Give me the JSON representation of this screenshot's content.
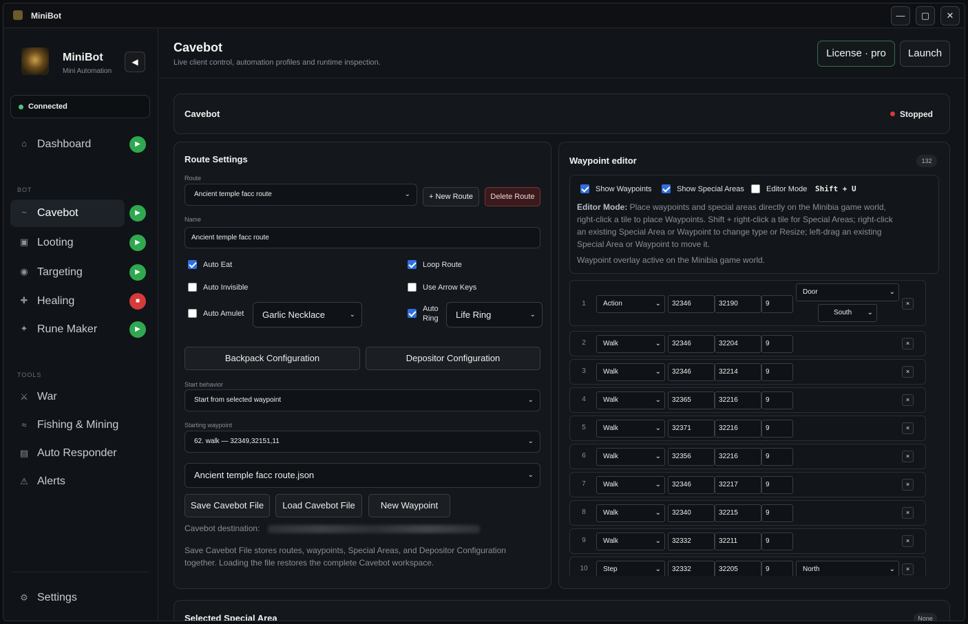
{
  "window": {
    "title": "MiniBot",
    "minimize": "—",
    "maximize": "▢",
    "close": "✕"
  },
  "sidebar": {
    "brand_name": "MiniBot",
    "brand_sub": "Mini Automation",
    "collapse": "◀",
    "connection": "Connected",
    "items": [
      {
        "label": "Dashboard",
        "icon": "⌂",
        "status": "running"
      },
      {
        "label": "Cavebot",
        "icon": "~",
        "status": "running"
      },
      {
        "label": "Looting",
        "icon": "▣",
        "status": "running"
      },
      {
        "label": "Targeting",
        "icon": "◉",
        "status": "running"
      },
      {
        "label": "Healing",
        "icon": "✚",
        "status": "stopped"
      },
      {
        "label": "Rune Maker",
        "icon": "✦",
        "status": "running"
      }
    ],
    "bot_section": "BOT",
    "tools_section": "TOOLS",
    "tools": [
      {
        "label": "War",
        "icon": "⚔"
      },
      {
        "label": "Fishing & Mining",
        "icon": "≈"
      },
      {
        "label": "Auto Responder",
        "icon": "▤"
      },
      {
        "label": "Alerts",
        "icon": "⚠"
      }
    ],
    "settings": {
      "label": "Settings",
      "icon": "⚙"
    },
    "play_glyph": "▶",
    "stop_glyph": "■"
  },
  "header": {
    "title": "Cavebot",
    "subtitle": "Live client control, automation profiles and runtime inspection.",
    "license": "License · pro",
    "launch": "Launch"
  },
  "status_card": {
    "title": "Cavebot",
    "status": "Stopped"
  },
  "route": {
    "title": "Route Settings",
    "route_label": "Route",
    "route_value": "Ancient temple facc route",
    "new_route": "+ New Route",
    "delete_route": "Delete Route",
    "name_label": "Name",
    "name_value": "Ancient temple facc route",
    "auto_eat": "Auto Eat",
    "loop_route": "Loop Route",
    "auto_invisible": "Auto Invisible",
    "use_arrow_keys": "Use Arrow Keys",
    "auto_amulet": "Auto Amulet",
    "amulet_value": "Garlic Necklace",
    "auto_ring_1": "Auto",
    "auto_ring_2": "Ring",
    "ring_value": "Life Ring",
    "backpack_config": "Backpack Configuration",
    "depositor_config": "Depositor Configuration",
    "start_behavior_label": "Start behavior",
    "start_behavior_value": "Start from selected waypoint",
    "starting_wp_label": "Starting waypoint",
    "starting_wp_value": "62. walk — 32349,32151,11",
    "file_value": "Ancient temple facc route.json",
    "save_file": "Save Cavebot File",
    "load_file": "Load Cavebot File",
    "new_waypoint": "New Waypoint",
    "destination_label": "Cavebot destination:",
    "help_line1": "Save Cavebot File stores routes, waypoints, Special Areas, and Depositor Configuration",
    "help_line2": "together. Loading the file restores the complete Cavebot workspace."
  },
  "waypoints": {
    "title": "Waypoint editor",
    "count": "132",
    "show_waypoints": "Show Waypoints",
    "show_special": "Show Special Areas",
    "editor_mode": "Editor Mode",
    "shortcut": "Shift + U",
    "mode_title": "Editor Mode:",
    "mode_line1": " Place waypoints and special areas directly on the Minibia game world,",
    "mode_line2": "right-click a tile to place Waypoints. Shift + right-click a tile for Special Areas; right-click",
    "mode_line3": "an existing Special Area or Waypoint to change type or Resize; left-drag an existing",
    "mode_line4": "Special Area or Waypoint to move it.",
    "overlay": "Waypoint overlay active on the Minibia game world.",
    "rows": [
      {
        "n": "1",
        "type": "Action",
        "x": "32346",
        "y": "32190",
        "z": "9",
        "extra1": "Door",
        "extra2": "South"
      },
      {
        "n": "2",
        "type": "Walk",
        "x": "32346",
        "y": "32204",
        "z": "9"
      },
      {
        "n": "3",
        "type": "Walk",
        "x": "32346",
        "y": "32214",
        "z": "9"
      },
      {
        "n": "4",
        "type": "Walk",
        "x": "32365",
        "y": "32216",
        "z": "9"
      },
      {
        "n": "5",
        "type": "Walk",
        "x": "32371",
        "y": "32216",
        "z": "9"
      },
      {
        "n": "6",
        "type": "Walk",
        "x": "32356",
        "y": "32216",
        "z": "9"
      },
      {
        "n": "7",
        "type": "Walk",
        "x": "32346",
        "y": "32217",
        "z": "9"
      },
      {
        "n": "8",
        "type": "Walk",
        "x": "32340",
        "y": "32215",
        "z": "9"
      },
      {
        "n": "9",
        "type": "Walk",
        "x": "32332",
        "y": "32211",
        "z": "9"
      },
      {
        "n": "10",
        "type": "Step",
        "x": "32332",
        "y": "32205",
        "z": "9",
        "extra1": "North"
      }
    ],
    "remove": "×",
    "chev": "⌄"
  },
  "special_area": {
    "title": "Selected Special Area",
    "badge": "None"
  }
}
